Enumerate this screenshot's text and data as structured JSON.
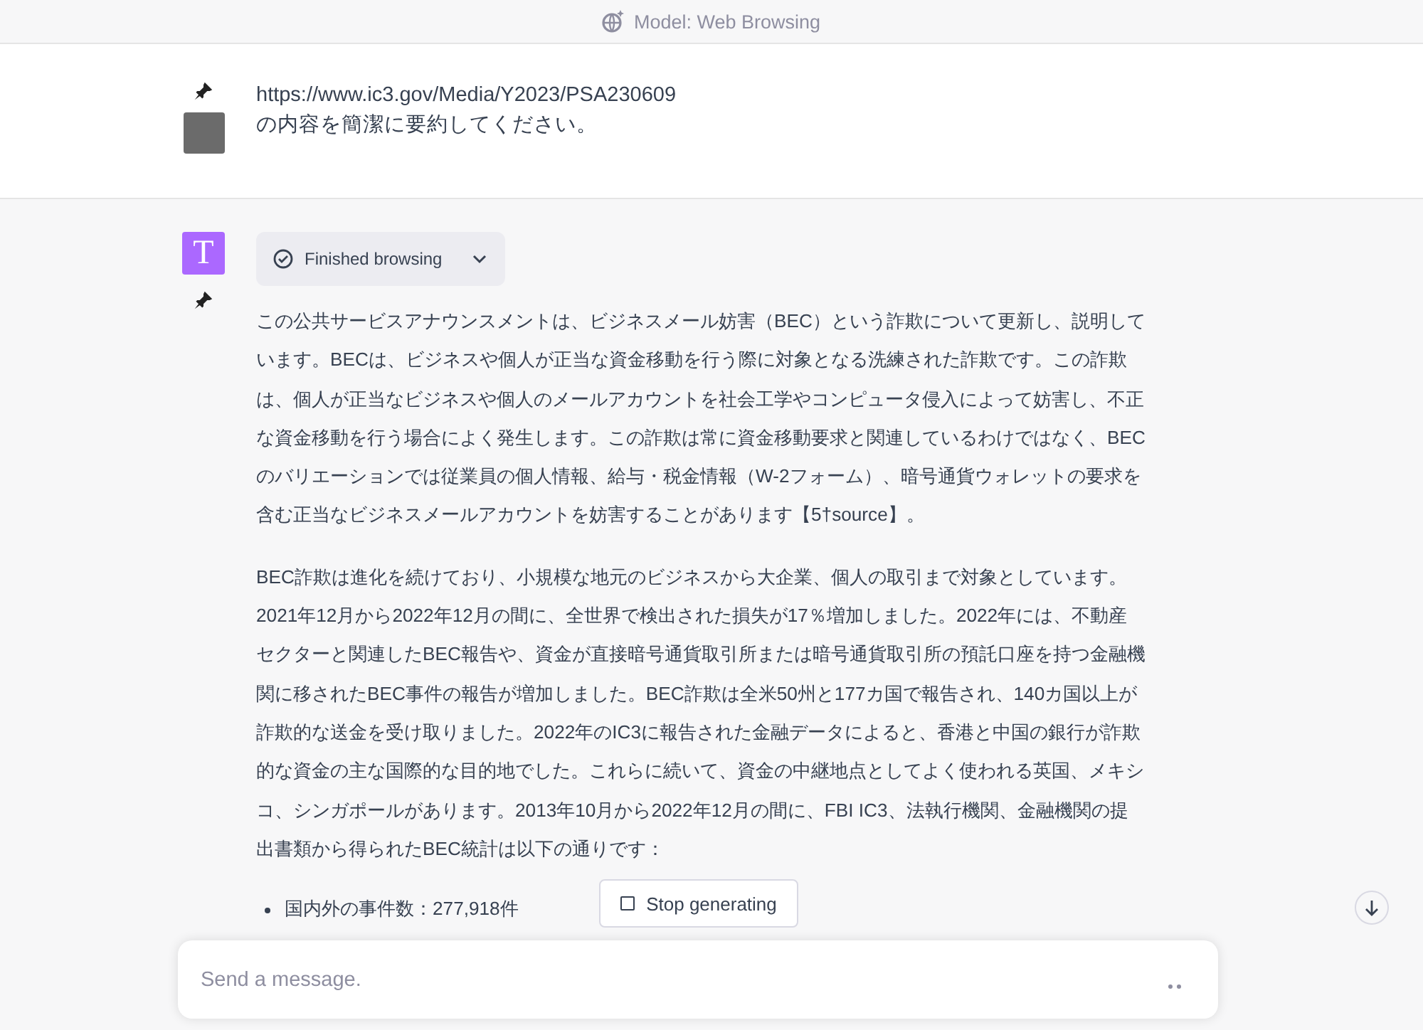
{
  "header": {
    "title": "Model: Web Browsing"
  },
  "user_message": {
    "pinned": true,
    "lines": [
      "https://www.ic3.gov/Media/Y2023/PSA230609",
      "の内容を簡潔に要約してください。"
    ]
  },
  "assistant_message": {
    "avatar_letter": "T",
    "pinned": true,
    "browsing": {
      "label": "Finished browsing",
      "expanded": false
    },
    "paragraphs": [
      "この公共サービスアナウンスメントは、ビジネスメール妨害（BEC）という詐欺について更新し、説明しています。BECは、ビジネスや個人が正当な資金移動を行う際に対象となる洗練された詐欺です。この詐欺は、個人が正当なビジネスや個人のメールアカウントを社会工学やコンピュータ侵入によって妨害し、不正な資金移動を行う場合によく発生します。この詐欺は常に資金移動要求と関連しているわけではなく、BECのバリエーションでは従業員の個人情報、給与・税金情報（W-2フォーム）、暗号通貨ウォレットの要求を含む正当なビジネスメールアカウントを妨害することがあります【5†source】。",
      "BEC詐欺は進化を続けており、小規模な地元のビジネスから大企業、個人の取引まで対象としています。2021年12月から2022年12月の間に、全世界で検出された損失が17％増加しました。2022年には、不動産セクターと関連したBEC報告や、資金が直接暗号通貨取引所または暗号通貨取引所の預託口座を持つ金融機関に移されたBEC事件の報告が増加しました。BEC詐欺は全米50州と177カ国で報告され、140カ国以上が詐欺的な送金を受け取りました。2022年のIC3に報告された金融データによると、香港と中国の銀行が詐欺的な資金の主な国際的な目的地でした。これらに続いて、資金の中継地点としてよく使われる英国、メキシコ、シンガポールがあります。2013年10月から2022年12月の間に、FBI IC3、法執行機関、金融機関の提出書類から得られたBEC統計は以下の通りです："
    ],
    "bullets": [
      "国内外の事件数：277,918件"
    ]
  },
  "stop_button": {
    "label": "Stop generating"
  },
  "composer": {
    "placeholder": "Send a message."
  }
}
